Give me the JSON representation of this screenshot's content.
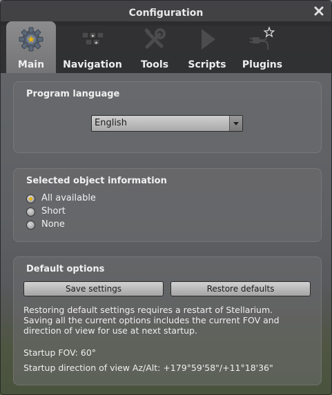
{
  "window": {
    "title": "Configuration"
  },
  "tabs": [
    {
      "label": "Main",
      "icon": "gear-icon",
      "active": true
    },
    {
      "label": "Navigation",
      "icon": "navigation-keys-icon",
      "active": false
    },
    {
      "label": "Tools",
      "icon": "tools-icon",
      "active": false
    },
    {
      "label": "Scripts",
      "icon": "play-icon",
      "active": false
    },
    {
      "label": "Plugins",
      "icon": "plugin-icon",
      "active": false
    }
  ],
  "language": {
    "title": "Program language",
    "selected": "English"
  },
  "object_info": {
    "title": "Selected object information",
    "options": [
      {
        "label": "All available",
        "checked": true
      },
      {
        "label": "Short",
        "checked": false
      },
      {
        "label": "None",
        "checked": false
      }
    ]
  },
  "defaults": {
    "title": "Default options",
    "save_label": "Save settings",
    "restore_label": "Restore defaults",
    "note_lines": [
      "Restoring default settings requires a restart of Stellarium.",
      "Saving all the current options includes the current FOV and",
      "direction of view for use at next startup."
    ],
    "startup_fov": "Startup FOV: 60°",
    "startup_direction": "Startup direction of view Az/Alt: +179°59'58\"/+11°18'36\""
  },
  "colors": {
    "accent_radio": "#e7b200",
    "active_tab": "#808082"
  }
}
